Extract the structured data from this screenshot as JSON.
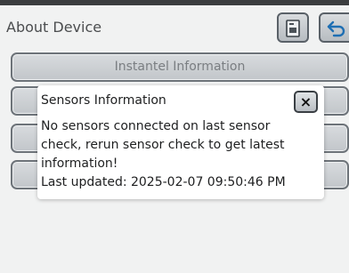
{
  "header": {
    "title": "About Device"
  },
  "menu": {
    "items": [
      {
        "label": "Instantel Information"
      },
      {
        "label": ""
      },
      {
        "label": ""
      },
      {
        "label": ""
      }
    ]
  },
  "popup": {
    "title": "Sensors Information",
    "close_symbol": "×",
    "message_line1": "No sensors connected on last sensor",
    "message_line2": "check, rerun sensor check to get latest",
    "message_line3": "information!",
    "last_updated": "Last updated: 2025-02-07 09:50:46 PM"
  },
  "icons": {
    "file": "file-icon",
    "back": "back-arrow-icon",
    "close": "close-icon"
  },
  "colors": {
    "background": "#f1f2f2",
    "button_border": "#6d7379",
    "popup_bg": "#ffffff",
    "header_bar": "#3b3d3f"
  }
}
